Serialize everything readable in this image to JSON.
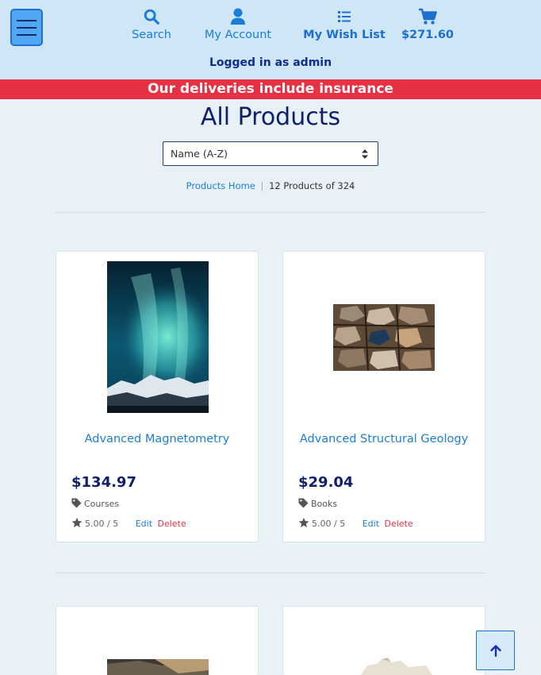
{
  "nav": {
    "search_label": "Search",
    "account_label": "My Account",
    "wishlist_label": "My Wish List",
    "cart_total": "$271.60",
    "logged_in_text": "Logged in as admin",
    "icons": [
      "menu-icon",
      "search-icon",
      "user-icon",
      "list-icon",
      "cart-icon"
    ]
  },
  "banner": {
    "text": "Our deliveries include insurance"
  },
  "page": {
    "title": "All Products"
  },
  "sort": {
    "selected": "Name (A-Z)"
  },
  "breadcrumb": {
    "home_link": "Products Home",
    "separator": "|",
    "count_text": "12 Products of 324"
  },
  "products": [
    {
      "name": "Advanced Magnetometry",
      "price": "$134.97",
      "category": "Courses",
      "rating": "5.00 / 5",
      "edit_label": "Edit",
      "delete_label": "Delete"
    },
    {
      "name": "Advanced Structural Geology",
      "price": "$29.04",
      "category": "Books",
      "rating": "5.00 / 5",
      "edit_label": "Edit",
      "delete_label": "Delete"
    }
  ],
  "colors": {
    "header_bg": "#cfe6f6",
    "banner_bg": "#e63145",
    "accent_blue": "#1b7dd6",
    "title_navy": "#0e1f6b"
  }
}
